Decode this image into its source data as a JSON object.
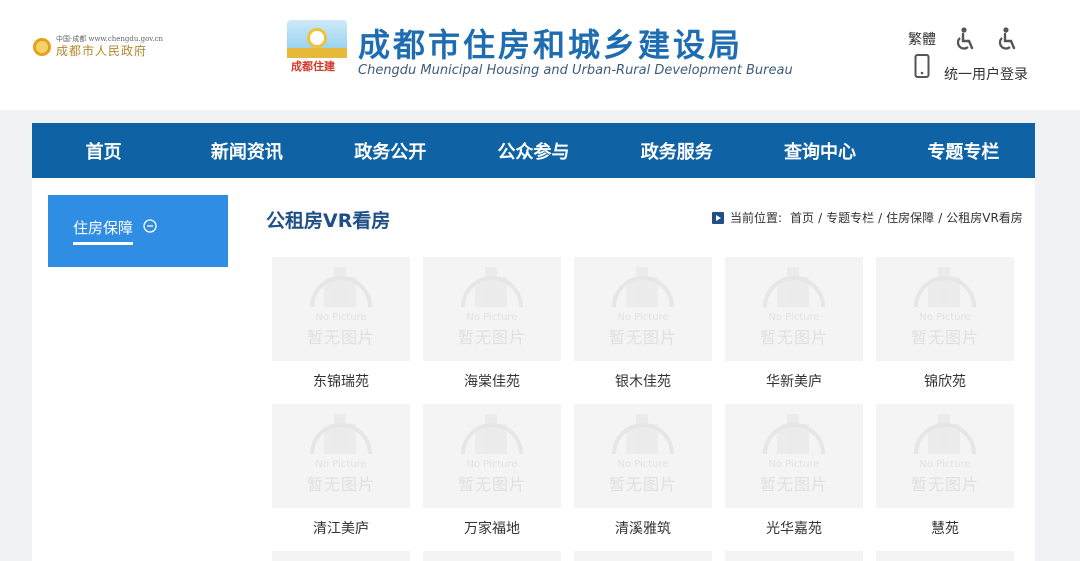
{
  "header": {
    "gov_small": "中国·成都 www.chengdu.gov.cn",
    "gov_name": "成都市人民政府",
    "bureau_badge": "成都住建",
    "title_cn": "成都市住房和城乡建设局",
    "title_en": "Chengdu Municipal Housing and Urban-Rural Development Bureau",
    "traditional": "繁體",
    "login": "统一用户登录"
  },
  "nav": {
    "items": [
      "首页",
      "新闻资讯",
      "政务公开",
      "公众参与",
      "政务服务",
      "查询中心",
      "专题专栏"
    ]
  },
  "sidebar": {
    "item": "住房保障"
  },
  "main": {
    "title": "公租房VR看房",
    "breadcrumb": {
      "label": "当前位置:",
      "items": [
        "首页",
        "专题专栏",
        "住房保障",
        "公租房VR看房"
      ]
    },
    "no_picture_en": "No Picture",
    "no_picture_cn": "暂无图片",
    "cards": [
      "东锦瑞苑",
      "海棠佳苑",
      "银木佳苑",
      "华新美庐",
      "锦欣苑",
      "清江美庐",
      "万家福地",
      "清溪雅筑",
      "光华嘉苑",
      "慧苑"
    ]
  },
  "colors": {
    "nav": "#0f63a5",
    "sidebar_active": "#2f8de4",
    "title": "#1e6db2"
  }
}
